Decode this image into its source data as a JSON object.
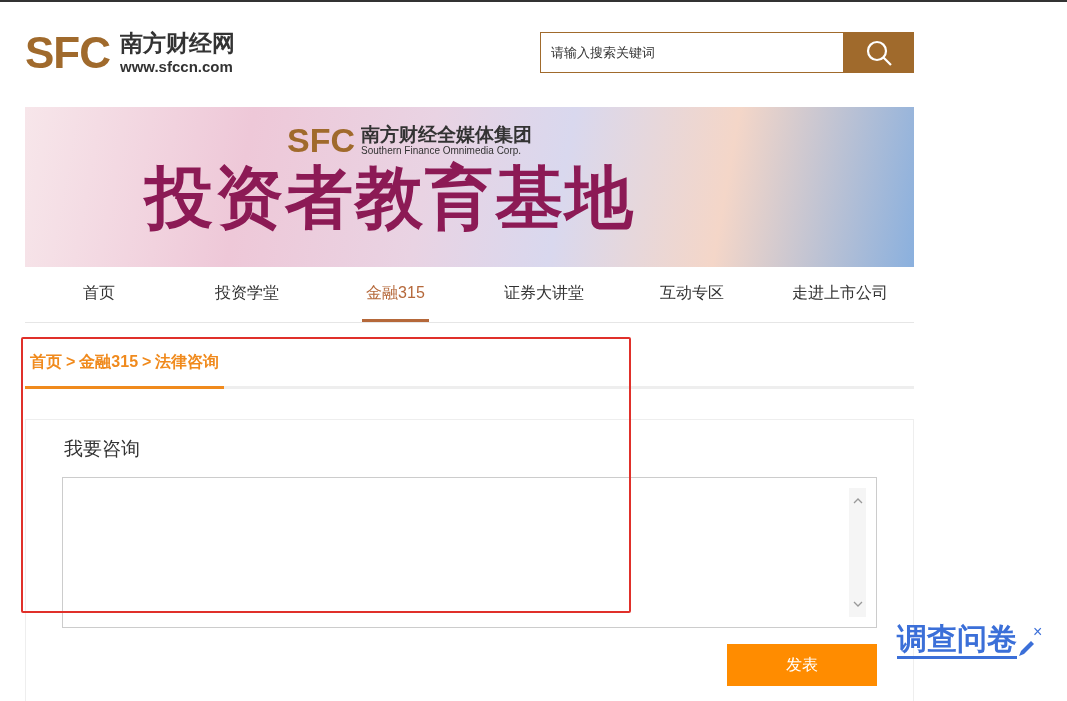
{
  "header": {
    "logo_letters": "SFC",
    "site_name": "南方财经网",
    "site_url": "www.sfccn.com",
    "search": {
      "placeholder": "请输入搜索关键词"
    }
  },
  "banner": {
    "logo_letters": "SFC",
    "group_name": "南方财经全媒体集团",
    "group_name_en": "Southern Finance Omnimedia Corp.",
    "title": "投资者教育基地"
  },
  "nav": [
    {
      "label": "首页",
      "selected": false
    },
    {
      "label": "投资学堂",
      "selected": false
    },
    {
      "label": "金融315",
      "selected": true
    },
    {
      "label": "证券大讲堂",
      "selected": false
    },
    {
      "label": "互动专区",
      "selected": false
    },
    {
      "label": "走进上市公司",
      "selected": false
    }
  ],
  "breadcrumb": [
    "首页",
    "金融315",
    "法律咨询"
  ],
  "breadcrumb_separator": ">",
  "form": {
    "title": "我要咨询",
    "submit": "发表"
  },
  "survey": {
    "label": "调查问卷",
    "close": "×"
  }
}
